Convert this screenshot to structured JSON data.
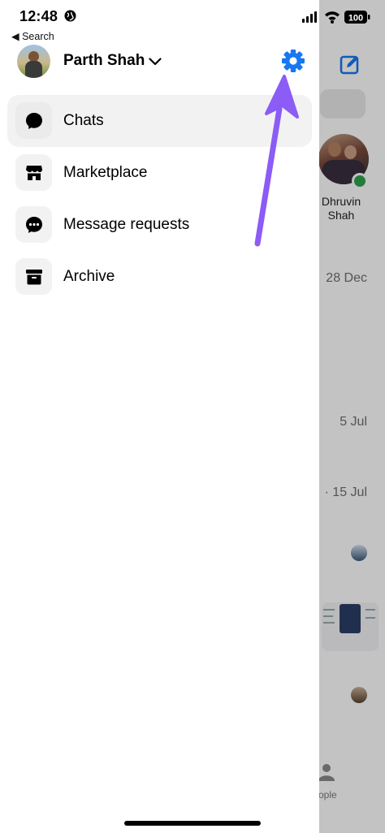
{
  "status_bar": {
    "time": "12:48",
    "back_label": "◀ Search",
    "battery": "100"
  },
  "profile": {
    "name": "Parth Shah"
  },
  "menu": [
    {
      "label": "Chats",
      "icon": "chat-bubble-icon",
      "active": true
    },
    {
      "label": "Marketplace",
      "icon": "storefront-icon",
      "active": false
    },
    {
      "label": "Message requests",
      "icon": "message-requests-icon",
      "active": false
    },
    {
      "label": "Archive",
      "icon": "archive-box-icon",
      "active": false
    }
  ],
  "background": {
    "story_name": "Dhruvin Shah",
    "dates": [
      "28 Dec",
      "5 Jul",
      "· 15 Jul"
    ],
    "people_label": "ople"
  },
  "colors": {
    "accent": "#1877f2",
    "annotation_arrow": "#8b5cf6",
    "online": "#31a24c"
  }
}
